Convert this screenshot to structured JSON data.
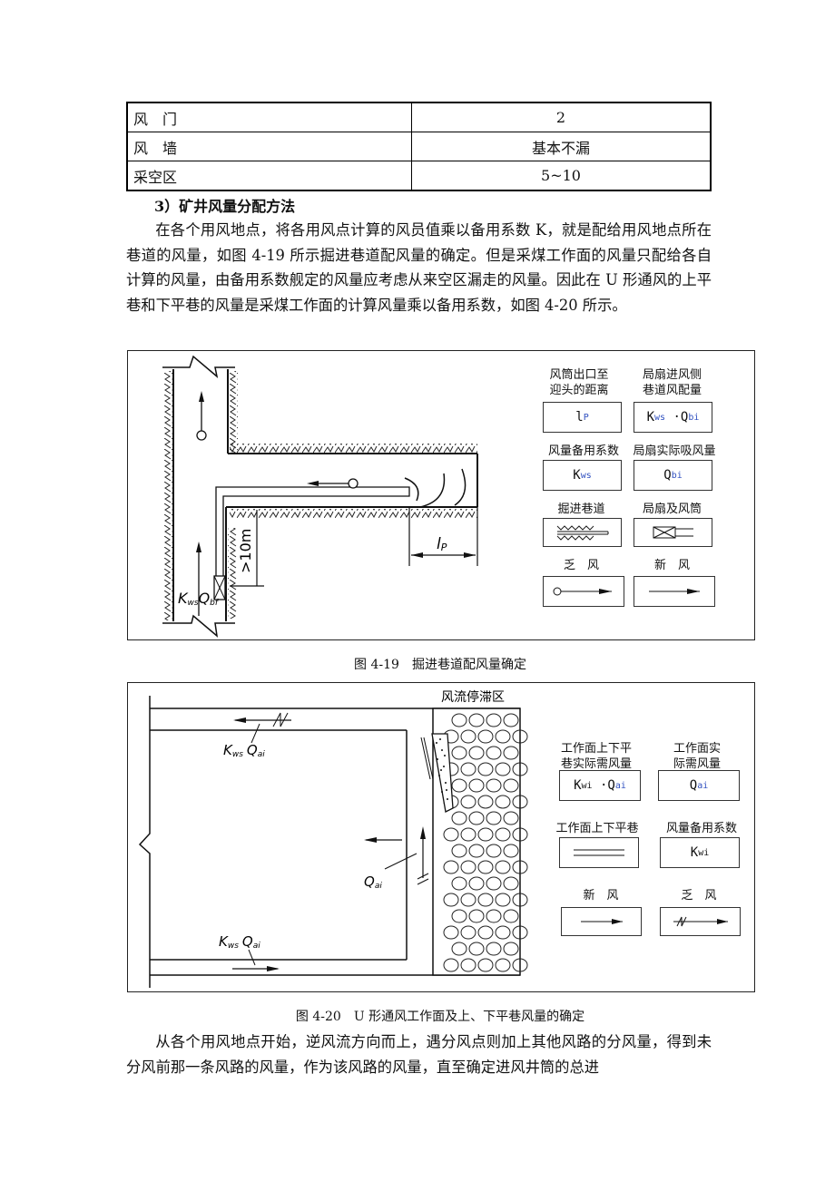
{
  "table": {
    "rows": [
      {
        "item": "风　门",
        "value": "2"
      },
      {
        "item": "风　墙",
        "value": "基本不漏"
      },
      {
        "item": "采空区",
        "value": "5~10"
      }
    ]
  },
  "section": {
    "heading": "3）矿井风量分配方法",
    "paragraph1": "在各个用风地点，将各用风点计算的风员值乘以备用系数 K，就是配给用风地点所在巷道的风量，如图 4-19 所示掘进巷道配风量的确定。但是采煤工作面的风量只配给各自计算的风量，由备用系数舰定的风量应考虑从来空区漏走的风量。因此在 U 形通风的上平巷和下平巷的风量是采煤工作面的计算风量乘以备用系数，如图 4-20 所示。",
    "paragraph2": "从各个用风地点开始，逆风流方向而上，遇分风点则加上其他风路的分风量，得到未分风前那一条风路的风量，作为该风路的风量，直至确定进风井筒的总进"
  },
  "figure19": {
    "caption": "图 4-19　掘进巷道配风量确定",
    "labels": {
      "kws_qbf": "K",
      "kws_qbf_sub1": "ws",
      "kws_qbf_q": "Q",
      "kws_qbf_sub2": "bf",
      "distance": ">10m",
      "lp": "l",
      "lp_sub": "P"
    },
    "legend": [
      {
        "label": "风筒出口至\n迎头的距离",
        "symbol": "l",
        "sub": "P"
      },
      {
        "label": "局扇进风侧\n巷道风配量",
        "symbol": "Kws·Qbi"
      },
      {
        "label": "风量备用系数",
        "symbol": "K",
        "sub": "ws"
      },
      {
        "label": "局扇实际吸风量",
        "symbol": "Q",
        "sub": "bi"
      },
      {
        "label": "掘进巷道",
        "symbol": "tunnel"
      },
      {
        "label": "局扇及风筒",
        "symbol": "fan-duct"
      },
      {
        "label": "乏　风",
        "symbol": "return-air"
      },
      {
        "label": "新　风",
        "symbol": "fresh-air"
      }
    ]
  },
  "figure20": {
    "caption": "图 4-20　U 形通风工作面及上、下平巷风量的确定",
    "labels": {
      "stagnant_zone": "风流停滞区",
      "top_formula_k": "K",
      "top_formula_ksub": "ws",
      "top_formula_q": "Q",
      "top_formula_qsub": "ai",
      "face_q": "Q",
      "face_qsub": "ai",
      "bottom_formula_k": "K",
      "bottom_formula_ksub": "ws",
      "bottom_formula_q": "Q",
      "bottom_formula_qsub": "ai"
    },
    "legend": [
      {
        "label": "工作面上下平\n巷实际需风量",
        "symbol": "Kwi·Qai"
      },
      {
        "label": "工作面实\n际需风量",
        "symbol": "Q",
        "sub": "ai"
      },
      {
        "label": "工作面上下平巷",
        "symbol": "double-line"
      },
      {
        "label": "风量备用系数",
        "symbol": "K",
        "sub": "wi"
      },
      {
        "label": "新　风",
        "symbol": "fresh-air"
      },
      {
        "label": "乏　风",
        "symbol": "return-air"
      }
    ]
  }
}
